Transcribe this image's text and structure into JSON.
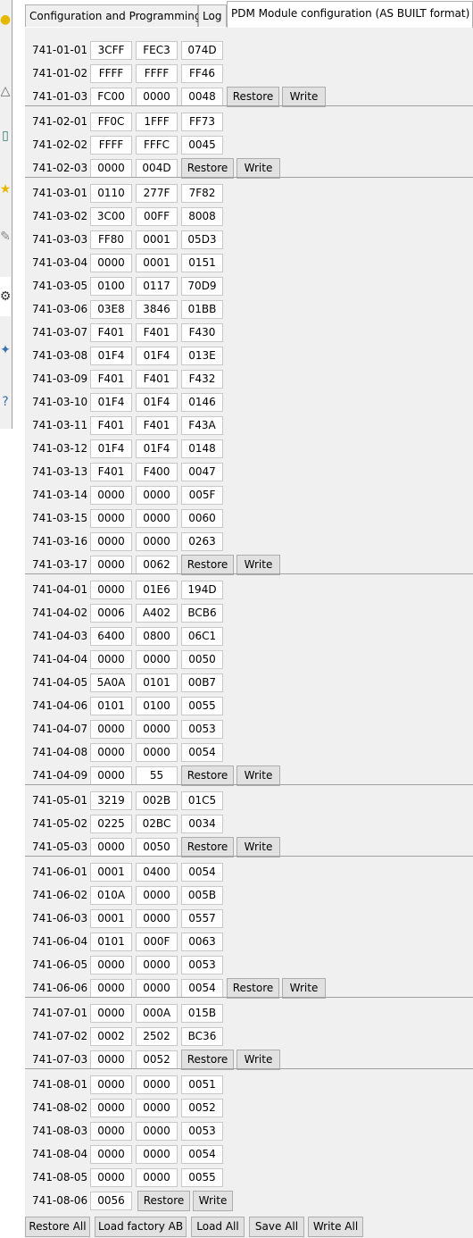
{
  "sidebar": {
    "icons": [
      "lightbulb-icon",
      "warning-icon",
      "phone-icon",
      "star-icon",
      "pen-icon",
      "gear-icon",
      "puzzle-icon",
      "help-icon"
    ]
  },
  "tabs": [
    {
      "label": "Configuration and Programming"
    },
    {
      "label": "Log"
    },
    {
      "label": "PDM Module configuration (AS BUILT format)"
    }
  ],
  "groups": [
    {
      "rows": [
        {
          "id": "741-01-01",
          "values": [
            "3CFF",
            "FEC3",
            "074D"
          ]
        },
        {
          "id": "741-01-02",
          "values": [
            "FFFF",
            "FFFF",
            "FF46"
          ]
        },
        {
          "id": "741-01-03",
          "values": [
            "FC00",
            "0000",
            "0048"
          ]
        }
      ]
    },
    {
      "rows": [
        {
          "id": "741-02-01",
          "values": [
            "FF0C",
            "1FFF",
            "FF73"
          ]
        },
        {
          "id": "741-02-02",
          "values": [
            "FFFF",
            "FFFC",
            "0045"
          ]
        },
        {
          "id": "741-02-03",
          "values": [
            "0000",
            "004D"
          ]
        }
      ]
    },
    {
      "rows": [
        {
          "id": "741-03-01",
          "values": [
            "0110",
            "277F",
            "7F82"
          ]
        },
        {
          "id": "741-03-02",
          "values": [
            "3C00",
            "00FF",
            "8008"
          ]
        },
        {
          "id": "741-03-03",
          "values": [
            "FF80",
            "0001",
            "05D3"
          ]
        },
        {
          "id": "741-03-04",
          "values": [
            "0000",
            "0001",
            "0151"
          ]
        },
        {
          "id": "741-03-05",
          "values": [
            "0100",
            "0117",
            "70D9"
          ]
        },
        {
          "id": "741-03-06",
          "values": [
            "03E8",
            "3846",
            "01BB"
          ]
        },
        {
          "id": "741-03-07",
          "values": [
            "F401",
            "F401",
            "F430"
          ]
        },
        {
          "id": "741-03-08",
          "values": [
            "01F4",
            "01F4",
            "013E"
          ]
        },
        {
          "id": "741-03-09",
          "values": [
            "F401",
            "F401",
            "F432"
          ]
        },
        {
          "id": "741-03-10",
          "values": [
            "01F4",
            "01F4",
            "0146"
          ]
        },
        {
          "id": "741-03-11",
          "values": [
            "F401",
            "F401",
            "F43A"
          ]
        },
        {
          "id": "741-03-12",
          "values": [
            "01F4",
            "01F4",
            "0148"
          ]
        },
        {
          "id": "741-03-13",
          "values": [
            "F401",
            "F400",
            "0047"
          ]
        },
        {
          "id": "741-03-14",
          "values": [
            "0000",
            "0000",
            "005F"
          ]
        },
        {
          "id": "741-03-15",
          "values": [
            "0000",
            "0000",
            "0060"
          ]
        },
        {
          "id": "741-03-16",
          "values": [
            "0000",
            "0000",
            "0263"
          ]
        },
        {
          "id": "741-03-17",
          "values": [
            "0000",
            "0062"
          ]
        }
      ]
    },
    {
      "rows": [
        {
          "id": "741-04-01",
          "values": [
            "0000",
            "01E6",
            "194D"
          ]
        },
        {
          "id": "741-04-02",
          "values": [
            "0006",
            "A402",
            "BCB6"
          ]
        },
        {
          "id": "741-04-03",
          "values": [
            "6400",
            "0800",
            "06C1"
          ]
        },
        {
          "id": "741-04-04",
          "values": [
            "0000",
            "0000",
            "0050"
          ]
        },
        {
          "id": "741-04-05",
          "values": [
            "5A0A",
            "0101",
            "00B7"
          ]
        },
        {
          "id": "741-04-06",
          "values": [
            "0101",
            "0100",
            "0055"
          ]
        },
        {
          "id": "741-04-07",
          "values": [
            "0000",
            "0000",
            "0053"
          ]
        },
        {
          "id": "741-04-08",
          "values": [
            "0000",
            "0000",
            "0054"
          ]
        },
        {
          "id": "741-04-09",
          "values": [
            "0000",
            "55"
          ]
        }
      ]
    },
    {
      "rows": [
        {
          "id": "741-05-01",
          "values": [
            "3219",
            "002B",
            "01C5"
          ]
        },
        {
          "id": "741-05-02",
          "values": [
            "0225",
            "02BC",
            "0034"
          ]
        },
        {
          "id": "741-05-03",
          "values": [
            "0000",
            "0050"
          ]
        }
      ]
    },
    {
      "rows": [
        {
          "id": "741-06-01",
          "values": [
            "0001",
            "0400",
            "0054"
          ]
        },
        {
          "id": "741-06-02",
          "values": [
            "010A",
            "0000",
            "005B"
          ]
        },
        {
          "id": "741-06-03",
          "values": [
            "0001",
            "0000",
            "0557"
          ]
        },
        {
          "id": "741-06-04",
          "values": [
            "0101",
            "000F",
            "0063"
          ]
        },
        {
          "id": "741-06-05",
          "values": [
            "0000",
            "0000",
            "0053"
          ]
        },
        {
          "id": "741-06-06",
          "values": [
            "0000",
            "0000",
            "0054"
          ]
        }
      ]
    },
    {
      "rows": [
        {
          "id": "741-07-01",
          "values": [
            "0000",
            "000A",
            "015B"
          ]
        },
        {
          "id": "741-07-02",
          "values": [
            "0002",
            "2502",
            "BC36"
          ]
        },
        {
          "id": "741-07-03",
          "values": [
            "0000",
            "0052"
          ]
        }
      ]
    },
    {
      "rows": [
        {
          "id": "741-08-01",
          "values": [
            "0000",
            "0000",
            "0051"
          ]
        },
        {
          "id": "741-08-02",
          "values": [
            "0000",
            "0000",
            "0052"
          ]
        },
        {
          "id": "741-08-03",
          "values": [
            "0000",
            "0000",
            "0053"
          ]
        },
        {
          "id": "741-08-04",
          "values": [
            "0000",
            "0000",
            "0054"
          ]
        },
        {
          "id": "741-08-05",
          "values": [
            "0000",
            "0000",
            "0055"
          ]
        },
        {
          "id": "741-08-06",
          "values": [
            "0056"
          ]
        }
      ]
    }
  ],
  "labels": {
    "restore": "Restore",
    "write": "Write"
  },
  "footer": [
    {
      "label": "Restore All"
    },
    {
      "label": "Load factory AB"
    },
    {
      "label": "Load All"
    },
    {
      "label": "Save All"
    },
    {
      "label": "Write All"
    }
  ]
}
